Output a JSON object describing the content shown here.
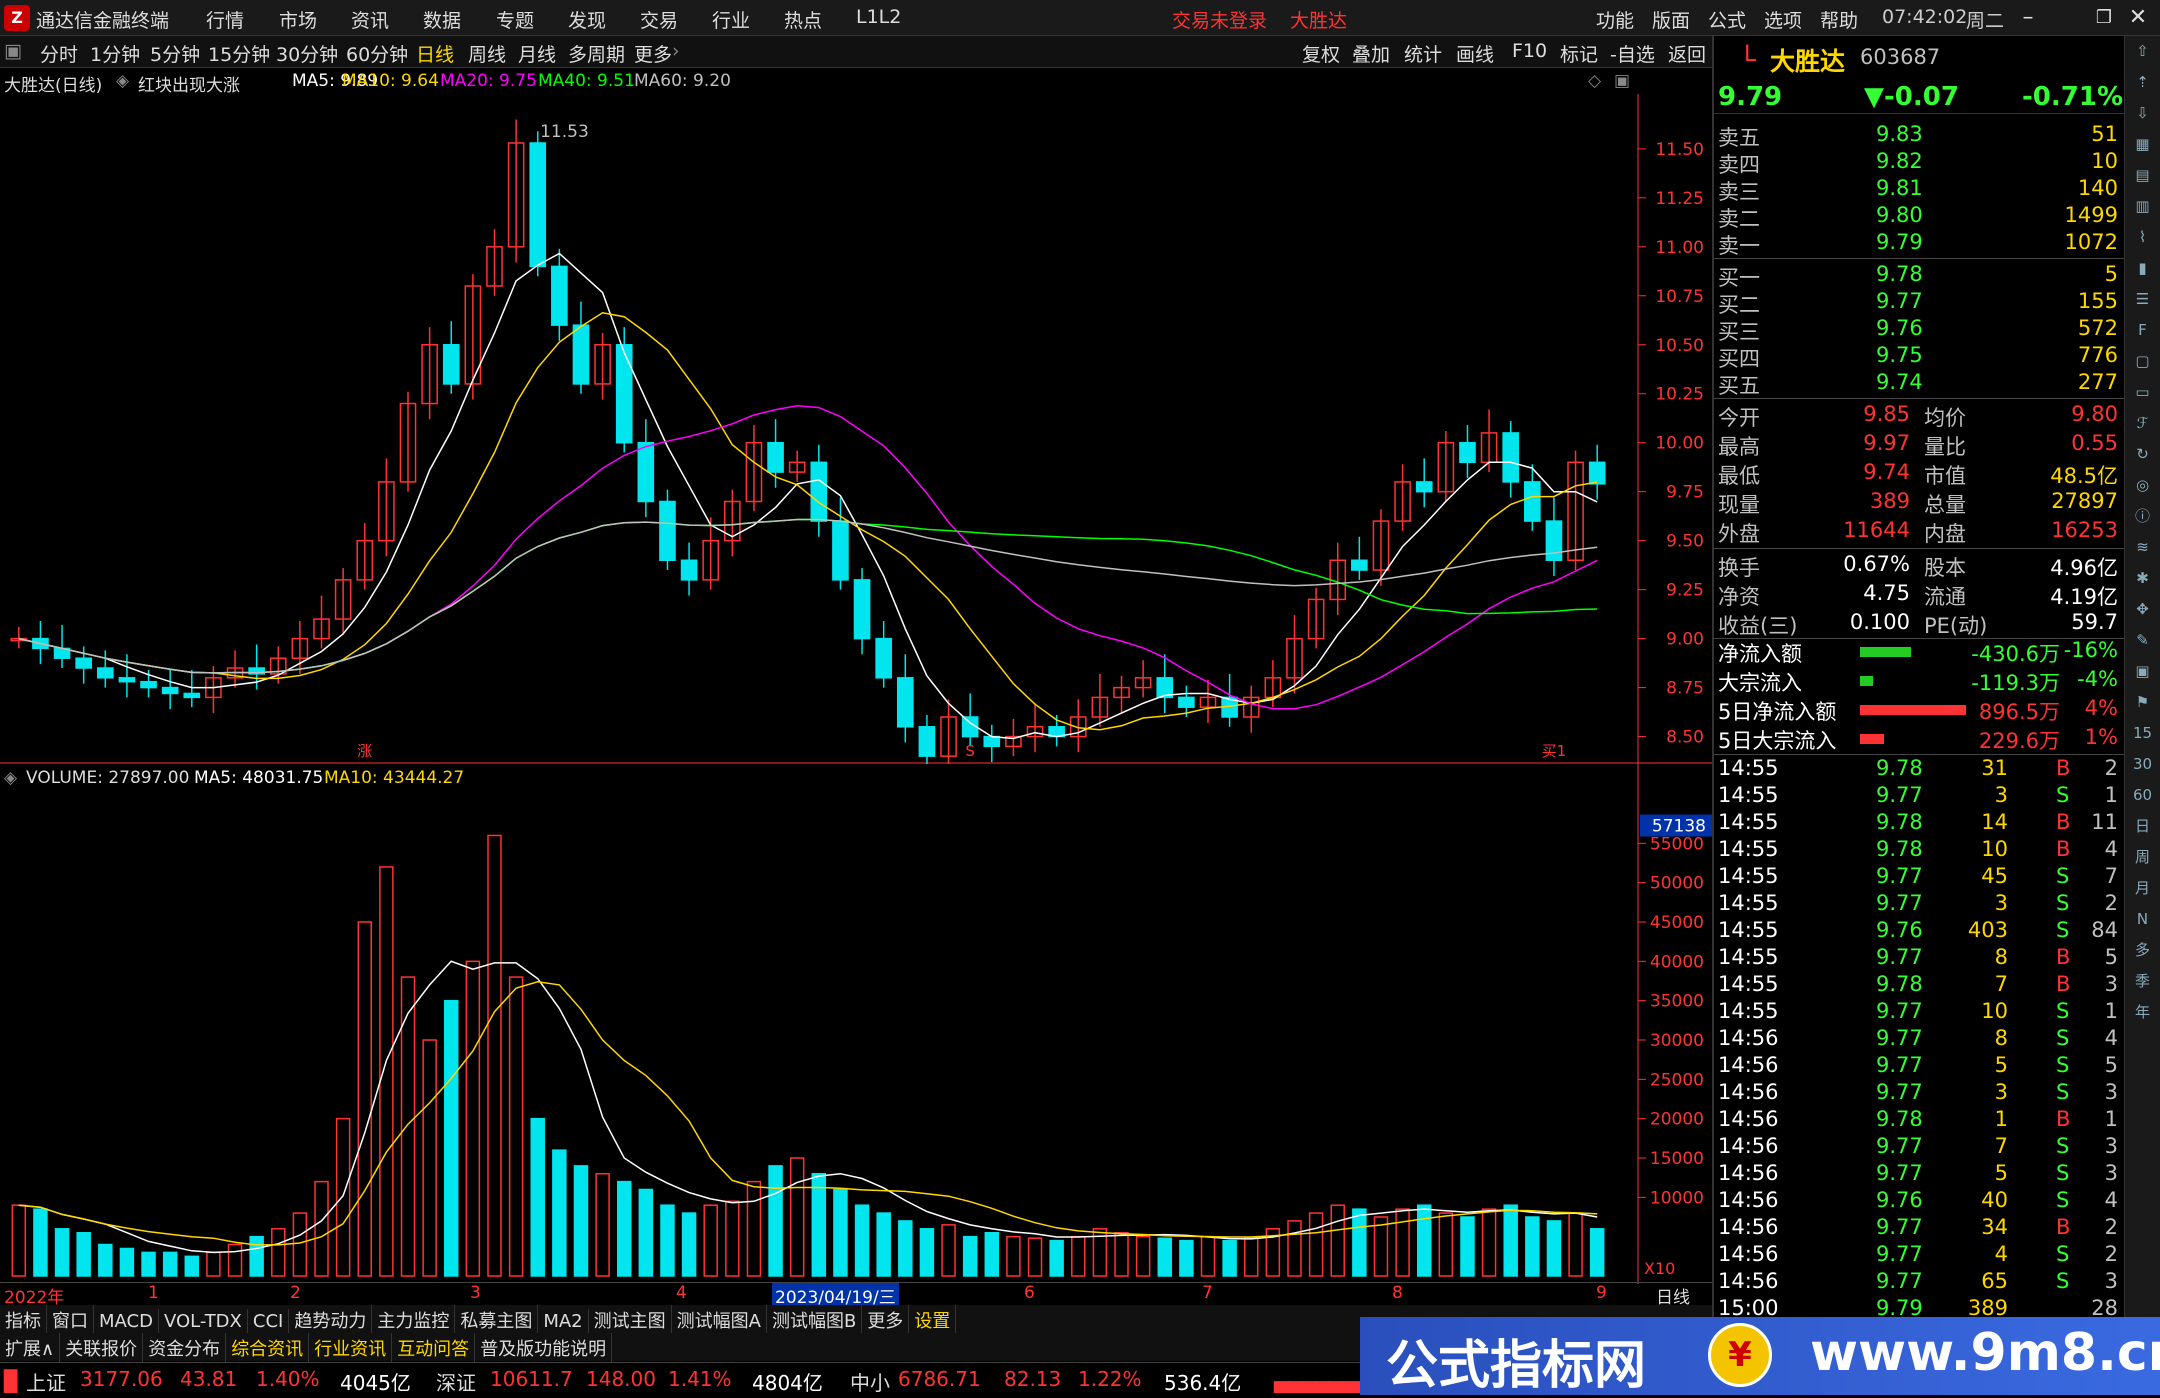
{
  "menubar": {
    "app_title": "通达信金融终端",
    "items": [
      "行情",
      "市场",
      "资讯",
      "数据",
      "专题",
      "发现",
      "交易",
      "行业",
      "热点",
      "L1L2"
    ],
    "alerts": [
      "交易未登录",
      "大胜达"
    ],
    "right_items": [
      "功能",
      "版面",
      "公式",
      "选项",
      "帮助"
    ],
    "time": "07:42:02",
    "weekday": "周二"
  },
  "periodbar": {
    "periods": [
      "分时",
      "1分钟",
      "5分钟",
      "15分钟",
      "30分钟",
      "60分钟",
      "日线",
      "周线",
      "月线",
      "多周期",
      "更多"
    ],
    "active": "日线",
    "tools": [
      "复权",
      "叠加",
      "统计",
      "画线",
      "F10",
      "标记",
      "-自选",
      "返回"
    ]
  },
  "chart_header": {
    "stock": "大胜达(日线)",
    "formula": "红块出现大涨",
    "ma5": "MA5: 9.89",
    "ma10": "MA10: 9.64",
    "ma20": "MA20: 9.75",
    "ma40": "MA40: 9.51",
    "ma60": "MA60: 9.20"
  },
  "volume_header": {
    "volume": "VOLUME: 27897.00",
    "ma5": "MA5: 48031.75",
    "ma10": "MA10: 43444.27"
  },
  "chart_data": [
    {
      "type": "candlestick",
      "title": "大胜达(日线)",
      "y_ticks": [
        11.5,
        11.25,
        11.0,
        10.75,
        10.5,
        10.25,
        10.0,
        9.75,
        9.5,
        9.25,
        9.0,
        8.75,
        8.5
      ],
      "ylim": [
        8.36,
        11.78
      ],
      "peak_label": "11.53",
      "markers": [
        "涨",
        "S",
        "买1"
      ],
      "close": [
        9.0,
        8.95,
        8.9,
        8.85,
        8.8,
        8.78,
        8.75,
        8.72,
        8.7,
        8.8,
        8.85,
        8.82,
        8.9,
        9.0,
        9.1,
        9.3,
        9.5,
        9.8,
        10.2,
        10.5,
        10.3,
        10.8,
        11.0,
        11.53,
        10.9,
        10.6,
        10.3,
        10.5,
        10.0,
        9.7,
        9.4,
        9.3,
        9.5,
        9.7,
        10.0,
        9.85,
        9.9,
        9.6,
        9.3,
        9.0,
        8.8,
        8.55,
        8.4,
        8.6,
        8.5,
        8.45,
        8.5,
        8.55,
        8.5,
        8.6,
        8.7,
        8.75,
        8.8,
        8.7,
        8.65,
        8.7,
        8.6,
        8.7,
        8.8,
        9.0,
        9.2,
        9.4,
        9.35,
        9.6,
        9.8,
        9.75,
        10.0,
        9.9,
        10.05,
        9.8,
        9.6,
        9.4,
        9.9,
        9.79
      ],
      "series": [
        {
          "name": "MA5",
          "color": "#ffffff"
        },
        {
          "name": "MA10",
          "color": "#ffd700"
        },
        {
          "name": "MA20",
          "color": "#ff00ff"
        },
        {
          "name": "MA40",
          "color": "#00ff00"
        },
        {
          "name": "MA60",
          "color": "#c0c0c0"
        }
      ]
    },
    {
      "type": "bar",
      "title": "VOLUME",
      "y_ticks": [
        55000,
        50000,
        45000,
        40000,
        35000,
        30000,
        25000,
        20000,
        15000,
        10000
      ],
      "ylim": [
        0,
        60000
      ],
      "highlight_value": "57138",
      "unit_label": "X10",
      "values": [
        9000,
        8500,
        6000,
        5500,
        4000,
        3500,
        3000,
        3000,
        2500,
        3000,
        4000,
        5000,
        6000,
        8000,
        12000,
        20000,
        45000,
        52000,
        38000,
        30000,
        35000,
        40000,
        56000,
        38000,
        20000,
        16000,
        14000,
        13000,
        12000,
        11000,
        9000,
        8000,
        9000,
        9500,
        12000,
        14000,
        15000,
        13000,
        11000,
        9000,
        8000,
        7000,
        6000,
        6500,
        5000,
        5500,
        5000,
        4800,
        4500,
        5000,
        6000,
        5500,
        5000,
        4800,
        4500,
        5000,
        4500,
        4800,
        6000,
        7000,
        8000,
        9000,
        8500,
        7500,
        8500,
        9000,
        8000,
        7500,
        8500,
        9000,
        7500,
        7000,
        8000,
        6000
      ]
    }
  ],
  "date_axis": [
    "2022年",
    "1",
    "2",
    "3",
    "4",
    "2023/04/19/三",
    "6",
    "7",
    "8",
    "9"
  ],
  "period_label": "日线",
  "tabs1": [
    "指标",
    "窗口",
    "MACD",
    "VOL-TDX",
    "CCI",
    "趋势动力",
    "主力监控",
    "私募主图",
    "MA2",
    "测试主图",
    "测试幅图A",
    "测试幅图B",
    "更多",
    "设置"
  ],
  "tabs2": [
    "扩展∧",
    "关联报价",
    "资金分布",
    "综合资讯",
    "行业资讯",
    "互动问答",
    "普及版功能说明"
  ],
  "quote": {
    "flag": "L",
    "name": "大胜达",
    "code": "603687",
    "price": "9.79",
    "change": "▼-0.07",
    "pct": "-0.71%",
    "asks": [
      {
        "label": "卖五",
        "price": "9.83",
        "vol": "51"
      },
      {
        "label": "卖四",
        "price": "9.82",
        "vol": "10"
      },
      {
        "label": "卖三",
        "price": "9.81",
        "vol": "140"
      },
      {
        "label": "卖二",
        "price": "9.80",
        "vol": "1499"
      },
      {
        "label": "卖一",
        "price": "9.79",
        "vol": "1072"
      }
    ],
    "bids": [
      {
        "label": "买一",
        "price": "9.78",
        "vol": "5"
      },
      {
        "label": "买二",
        "price": "9.77",
        "vol": "155"
      },
      {
        "label": "买三",
        "price": "9.76",
        "vol": "572"
      },
      {
        "label": "买四",
        "price": "9.75",
        "vol": "776"
      },
      {
        "label": "买五",
        "price": "9.74",
        "vol": "277"
      }
    ],
    "stats": [
      {
        "l1": "今开",
        "v1": "9.85",
        "l2": "均价",
        "v2": "9.80"
      },
      {
        "l1": "最高",
        "v1": "9.97",
        "l2": "量比",
        "v2": "0.55"
      },
      {
        "l1": "最低",
        "v1": "9.74",
        "l2": "市值",
        "v2": "48.5亿"
      },
      {
        "l1": "现量",
        "v1": "389",
        "l2": "总量",
        "v2": "27897"
      },
      {
        "l1": "外盘",
        "v1": "11644",
        "l2": "内盘",
        "v2": "16253"
      }
    ],
    "stats2": [
      {
        "l1": "换手",
        "v1": "0.67%",
        "l2": "股本",
        "v2": "4.96亿"
      },
      {
        "l1": "净资",
        "v1": "4.75",
        "l2": "流通",
        "v2": "4.19亿"
      },
      {
        "l1": "收益(三)",
        "v1": "0.100",
        "l2": "PE(动)",
        "v2": "59.7"
      }
    ],
    "flows": [
      {
        "label": "净流入额",
        "value": "-430.6万",
        "pct": "-16%",
        "bar_color": "#22cc22",
        "bar_frac": 0.46
      },
      {
        "label": "大宗流入",
        "value": "-119.3万",
        "pct": "-4%",
        "bar_color": "#22cc22",
        "bar_frac": 0.12
      },
      {
        "label": "5日净流入额",
        "value": "896.5万",
        "pct": "4%",
        "bar_color": "#ff3333",
        "bar_frac": 0.96
      },
      {
        "label": "5日大宗流入",
        "value": "229.6万",
        "pct": "1%",
        "bar_color": "#ff3333",
        "bar_frac": 0.22
      }
    ],
    "ticks": [
      {
        "t": "14:55",
        "p": "9.78",
        "v": "31",
        "d": "B",
        "n": "2"
      },
      {
        "t": "14:55",
        "p": "9.77",
        "v": "3",
        "d": "S",
        "n": "1"
      },
      {
        "t": "14:55",
        "p": "9.78",
        "v": "14",
        "d": "B",
        "n": "11"
      },
      {
        "t": "14:55",
        "p": "9.78",
        "v": "10",
        "d": "B",
        "n": "4"
      },
      {
        "t": "14:55",
        "p": "9.77",
        "v": "45",
        "d": "S",
        "n": "7"
      },
      {
        "t": "14:55",
        "p": "9.77",
        "v": "3",
        "d": "S",
        "n": "2"
      },
      {
        "t": "14:55",
        "p": "9.76",
        "v": "403",
        "d": "S",
        "n": "84"
      },
      {
        "t": "14:55",
        "p": "9.77",
        "v": "8",
        "d": "B",
        "n": "5"
      },
      {
        "t": "14:55",
        "p": "9.78",
        "v": "7",
        "d": "B",
        "n": "3"
      },
      {
        "t": "14:55",
        "p": "9.77",
        "v": "10",
        "d": "S",
        "n": "1"
      },
      {
        "t": "14:56",
        "p": "9.77",
        "v": "8",
        "d": "S",
        "n": "4"
      },
      {
        "t": "14:56",
        "p": "9.77",
        "v": "5",
        "d": "S",
        "n": "5"
      },
      {
        "t": "14:56",
        "p": "9.77",
        "v": "3",
        "d": "S",
        "n": "3"
      },
      {
        "t": "14:56",
        "p": "9.78",
        "v": "1",
        "d": "B",
        "n": "1"
      },
      {
        "t": "14:56",
        "p": "9.77",
        "v": "7",
        "d": "S",
        "n": "3"
      },
      {
        "t": "14:56",
        "p": "9.77",
        "v": "5",
        "d": "S",
        "n": "3"
      },
      {
        "t": "14:56",
        "p": "9.76",
        "v": "40",
        "d": "S",
        "n": "4"
      },
      {
        "t": "14:56",
        "p": "9.77",
        "v": "34",
        "d": "B",
        "n": "2"
      },
      {
        "t": "14:56",
        "p": "9.77",
        "v": "4",
        "d": "S",
        "n": "2"
      },
      {
        "t": "14:56",
        "p": "9.77",
        "v": "65",
        "d": "S",
        "n": "3"
      },
      {
        "t": "15:00",
        "p": "9.79",
        "v": "389",
        "d": "",
        "n": "28"
      }
    ]
  },
  "right_tools": [
    "15",
    "30",
    "60",
    "日",
    "周",
    "月",
    "N",
    "多",
    "季",
    "年"
  ],
  "statusbar": [
    {
      "name": "上证",
      "value": "3177.06",
      "chg": "43.81",
      "pct": "1.40%",
      "amt": "4045亿"
    },
    {
      "name": "深证",
      "value": "10611.7",
      "chg": "148.00",
      "pct": "1.41%",
      "amt": "4804亿"
    },
    {
      "name": "中小",
      "value": "6786.71",
      "chg": "82.13",
      "pct": "1.22%",
      "amt": "536.4亿"
    }
  ],
  "watermark": {
    "text": "公式指标网",
    "url": "www.9m8.cn",
    "coin": "¥"
  },
  "colors": {
    "up": "#ff3333",
    "down": "#00e5ee",
    "ma5": "#ffffff",
    "ma10": "#ffd700",
    "ma20": "#ff00ff",
    "ma40": "#00ff00",
    "ma60": "#c0c0c0"
  }
}
